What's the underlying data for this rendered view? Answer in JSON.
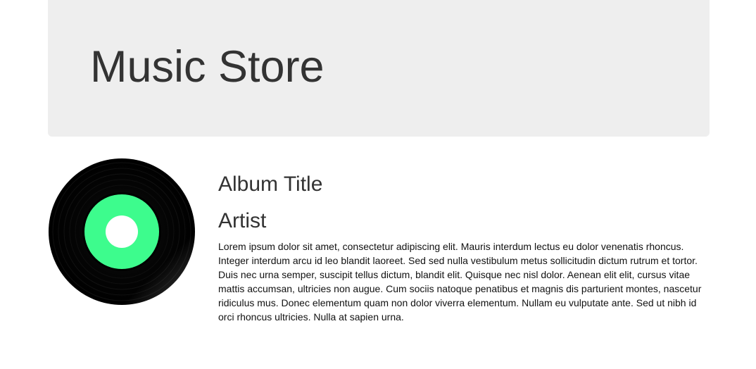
{
  "header": {
    "title": "Music Store"
  },
  "album": {
    "image_icon": "vinyl-record-icon",
    "title": "Album Title",
    "artist": "Artist",
    "description": "Lorem ipsum dolor sit amet, consectetur adipiscing elit. Mauris interdum lectus eu dolor venenatis rhoncus. Integer interdum arcu id leo blandit laoreet. Sed sed nulla vestibulum metus sollicitudin dictum rutrum et tortor. Duis nec urna semper, suscipit tellus dictum, blandit elit. Quisque nec nisl dolor. Aenean elit elit, cursus vitae mattis accumsan, ultricies non augue. Cum sociis natoque penatibus et magnis dis parturient montes, nascetur ridiculus mus. Donec elementum quam non dolor viverra elementum. Nullam eu vulputate ante. Sed ut nibh id orci rhoncus ultricies. Nulla at sapien urna."
  },
  "colors": {
    "header_background": "#eeeeee",
    "record_black": "#000000",
    "record_label_green": "#3dfc8d",
    "text": "#333333"
  }
}
